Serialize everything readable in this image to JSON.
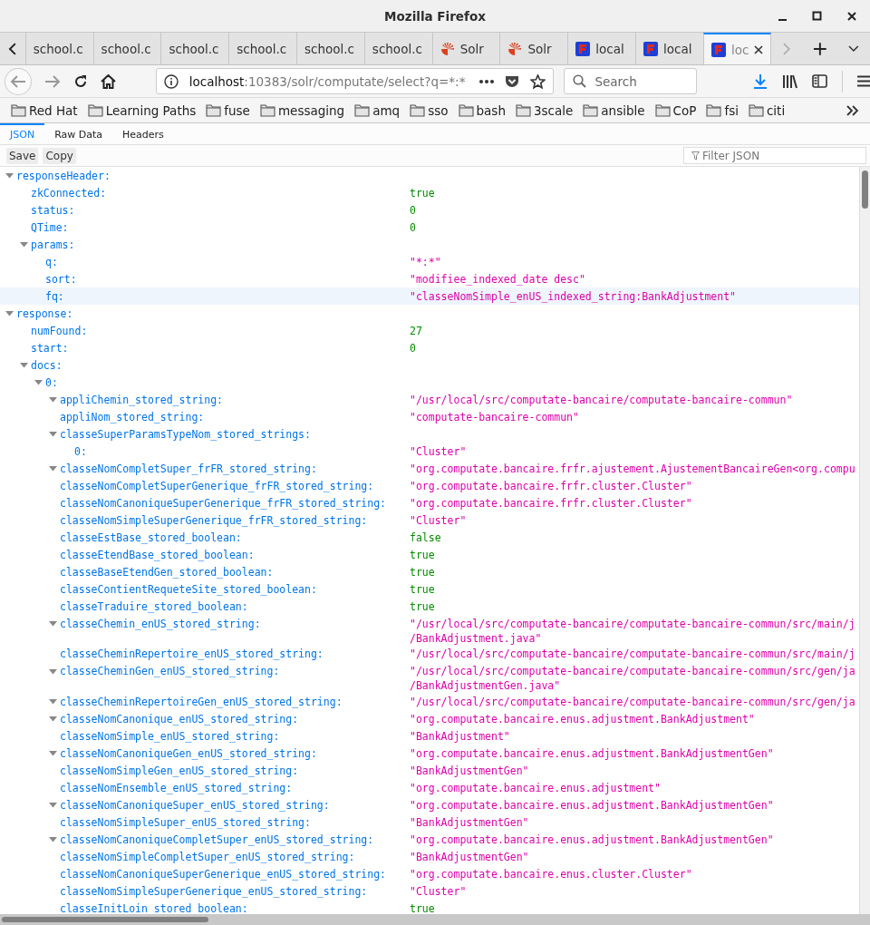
{
  "window": {
    "title": "Mozilla Firefox"
  },
  "tabs": [
    {
      "label": "school.c",
      "kind": "plain",
      "selected": false
    },
    {
      "label": "school.c",
      "kind": "plain",
      "selected": false
    },
    {
      "label": "school.c",
      "kind": "plain",
      "selected": false
    },
    {
      "label": "school.c",
      "kind": "plain",
      "selected": false
    },
    {
      "label": "school.c",
      "kind": "plain",
      "selected": false
    },
    {
      "label": "school.c",
      "kind": "plain",
      "selected": false
    },
    {
      "label": "Solr",
      "kind": "solr",
      "selected": false
    },
    {
      "label": "Solr",
      "kind": "solr",
      "selected": false
    },
    {
      "label": "local",
      "kind": "app",
      "selected": false
    },
    {
      "label": "local",
      "kind": "app",
      "selected": false
    },
    {
      "label": "loc",
      "kind": "app",
      "selected": true
    }
  ],
  "address": {
    "host": "localhost",
    "rest": ":10383/solr/computate/select?q=*:*"
  },
  "search": {
    "placeholder": "Search"
  },
  "bookmarks": [
    "Red Hat",
    "Learning Paths",
    "fuse",
    "messaging",
    "amq",
    "sso",
    "bash",
    "3scale",
    "ansible",
    "CoP",
    "fsi",
    "citi"
  ],
  "viewer_tabs": [
    {
      "label": "JSON",
      "selected": true
    },
    {
      "label": "Raw Data",
      "selected": false
    },
    {
      "label": "Headers",
      "selected": false
    }
  ],
  "toolbar": {
    "buttons": [
      "Save",
      "Copy"
    ],
    "filter": {
      "placeholder": "Filter JSON"
    }
  },
  "tree": [
    {
      "key": "responseHeader:",
      "expanded": true,
      "selected": false,
      "children": [
        {
          "key": "zkConnected:",
          "value": "true",
          "kind": "literal",
          "selected": false
        },
        {
          "key": "status:",
          "value": "0",
          "kind": "literal",
          "selected": false
        },
        {
          "key": "QTime:",
          "value": "0",
          "kind": "literal",
          "selected": false
        },
        {
          "key": "params:",
          "expanded": true,
          "selected": false,
          "children": [
            {
              "key": "q:",
              "value": "\"*:*\"",
              "kind": "string",
              "selected": false
            },
            {
              "key": "sort:",
              "value": "\"modifiee_indexed_date desc\"",
              "kind": "string",
              "selected": false
            },
            {
              "key": "fq:",
              "value": "\"classeNomSimple_enUS_indexed_string:BankAdjustment\"",
              "kind": "string",
              "selected": true
            }
          ]
        }
      ]
    },
    {
      "key": "response:",
      "expanded": true,
      "selected": false,
      "children": [
        {
          "key": "numFound:",
          "value": "27",
          "kind": "literal",
          "selected": false
        },
        {
          "key": "start:",
          "value": "0",
          "kind": "literal",
          "selected": false
        },
        {
          "key": "docs:",
          "expanded": true,
          "selected": false,
          "children": [
            {
              "key": "0:",
              "expanded": true,
              "selected": false,
              "children": [
                {
                  "key": "appliChemin_stored_string:",
                  "value": "\"/usr/local/src/computate-bancaire/computate-bancaire-commun\"",
                  "kind": "string",
                  "expanded": true,
                  "selected": false
                },
                {
                  "key": "appliNom_stored_string:",
                  "value": "\"computate-bancaire-commun\"",
                  "kind": "string",
                  "selected": false
                },
                {
                  "key": "classeSuperParamsTypeNom_stored_strings:",
                  "expanded": true,
                  "selected": false,
                  "children": [
                    {
                      "key": "0:",
                      "value": "\"Cluster\"",
                      "kind": "string",
                      "selected": false
                    }
                  ]
                },
                {
                  "key": "classeNomCompletSuper_frFR_stored_string:",
                  "value": "\"org.computate.bancaire.frfr.ajustement.AjustementBancaireGen<org.compu",
                  "kind": "string",
                  "expanded": true,
                  "selected": false
                },
                {
                  "key": "classeNomCompletSuperGenerique_frFR_stored_string:",
                  "value": "\"org.computate.bancaire.frfr.cluster.Cluster\"",
                  "kind": "string",
                  "selected": false
                },
                {
                  "key": "classeNomCanoniqueSuperGenerique_frFR_stored_string:",
                  "value": "\"org.computate.bancaire.frfr.cluster.Cluster\"",
                  "kind": "string",
                  "selected": false
                },
                {
                  "key": "classeNomSimpleSuperGenerique_frFR_stored_string:",
                  "value": "\"Cluster\"",
                  "kind": "string",
                  "selected": false
                },
                {
                  "key": "classeEstBase_stored_boolean:",
                  "value": "false",
                  "kind": "literal",
                  "selected": false
                },
                {
                  "key": "classeEtendBase_stored_boolean:",
                  "value": "true",
                  "kind": "literal",
                  "selected": false
                },
                {
                  "key": "classeBaseEtendGen_stored_boolean:",
                  "value": "true",
                  "kind": "literal",
                  "selected": false
                },
                {
                  "key": "classeContientRequeteSite_stored_boolean:",
                  "value": "true",
                  "kind": "literal",
                  "selected": false
                },
                {
                  "key": "classeTraduire_stored_boolean:",
                  "value": "true",
                  "kind": "literal",
                  "selected": false
                },
                {
                  "key": "classeChemin_enUS_stored_string:",
                  "value": "\"/usr/local/src/computate-bancaire/computate-bancaire-commun/src/main/j\n/BankAdjustment.java\"",
                  "kind": "string",
                  "expanded": true,
                  "selected": false
                },
                {
                  "key": "classeCheminRepertoire_enUS_stored_string:",
                  "value": "\"/usr/local/src/computate-bancaire/computate-bancaire-commun/src/main/j",
                  "kind": "string",
                  "selected": false
                },
                {
                  "key": "classeCheminGen_enUS_stored_string:",
                  "value": "\"/usr/local/src/computate-bancaire/computate-bancaire-commun/src/gen/ja\n/BankAdjustmentGen.java\"",
                  "kind": "string",
                  "expanded": true,
                  "selected": false
                },
                {
                  "key": "classeCheminRepertoireGen_enUS_stored_string:",
                  "value": "\"/usr/local/src/computate-bancaire/computate-bancaire-commun/src/gen/ja",
                  "kind": "string",
                  "expanded": true,
                  "selected": false
                },
                {
                  "key": "classeNomCanonique_enUS_stored_string:",
                  "value": "\"org.computate.bancaire.enus.adjustment.BankAdjustment\"",
                  "kind": "string",
                  "expanded": true,
                  "selected": false
                },
                {
                  "key": "classeNomSimple_enUS_stored_string:",
                  "value": "\"BankAdjustment\"",
                  "kind": "string",
                  "selected": false
                },
                {
                  "key": "classeNomCanoniqueGen_enUS_stored_string:",
                  "value": "\"org.computate.bancaire.enus.adjustment.BankAdjustmentGen\"",
                  "kind": "string",
                  "expanded": true,
                  "selected": false
                },
                {
                  "key": "classeNomSimpleGen_enUS_stored_string:",
                  "value": "\"BankAdjustmentGen\"",
                  "kind": "string",
                  "selected": false
                },
                {
                  "key": "classeNomEnsemble_enUS_stored_string:",
                  "value": "\"org.computate.bancaire.enus.adjustment\"",
                  "kind": "string",
                  "selected": false
                },
                {
                  "key": "classeNomCanoniqueSuper_enUS_stored_string:",
                  "value": "\"org.computate.bancaire.enus.adjustment.BankAdjustmentGen\"",
                  "kind": "string",
                  "expanded": true,
                  "selected": false
                },
                {
                  "key": "classeNomSimpleSuper_enUS_stored_string:",
                  "value": "\"BankAdjustmentGen\"",
                  "kind": "string",
                  "selected": false
                },
                {
                  "key": "classeNomCanoniqueCompletSuper_enUS_stored_string:",
                  "value": "\"org.computate.bancaire.enus.adjustment.BankAdjustmentGen\"",
                  "kind": "string",
                  "expanded": true,
                  "selected": false
                },
                {
                  "key": "classeNomSimpleCompletSuper_enUS_stored_string:",
                  "value": "\"BankAdjustmentGen\"",
                  "kind": "string",
                  "selected": false
                },
                {
                  "key": "classeNomCanoniqueSuperGenerique_enUS_stored_string:",
                  "value": "\"org.computate.bancaire.enus.cluster.Cluster\"",
                  "kind": "string",
                  "selected": false
                },
                {
                  "key": "classeNomSimpleSuperGenerique_enUS_stored_string:",
                  "value": "\"Cluster\"",
                  "kind": "string",
                  "selected": false
                },
                {
                  "key": "classeInitLoin_stored_boolean:",
                  "value": "true",
                  "kind": "literal",
                  "selected": false
                }
              ]
            }
          ]
        }
      ]
    }
  ]
}
